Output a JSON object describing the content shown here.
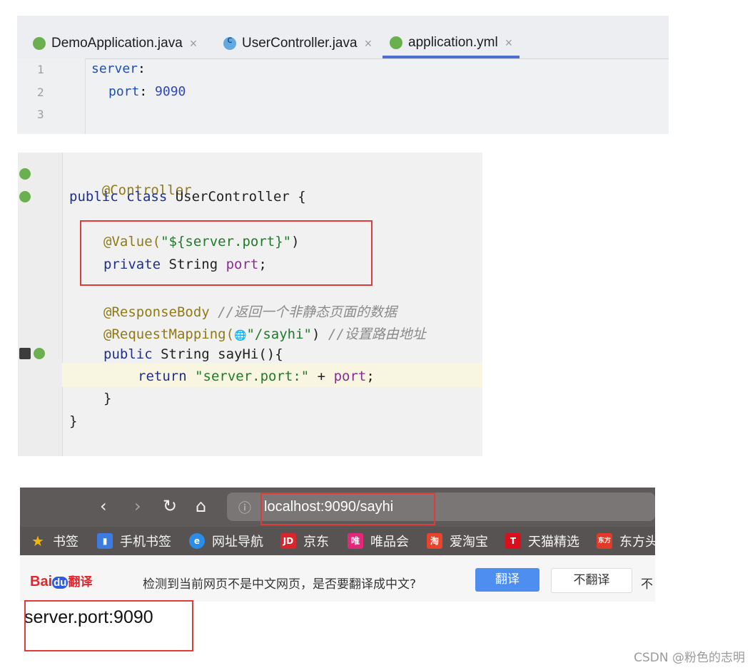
{
  "ide_tabs": {
    "tabs": [
      {
        "label": "DemoApplication.java",
        "icon": "spring-app-icon"
      },
      {
        "label": "UserController.java",
        "icon": "class-icon"
      },
      {
        "label": "application.yml",
        "icon": "spring-config-icon",
        "active": true
      }
    ],
    "close_glyph": "×"
  },
  "yaml_editor": {
    "line_numbers": [
      "1",
      "2",
      "3"
    ],
    "line1_key": "server",
    "line1_colon": ":",
    "line2_key": "port",
    "line2_colon": ":",
    "line2_value": "9090"
  },
  "java_editor": {
    "line_annotation": "@Controller",
    "line_class_kw": "public class",
    "line_class_name": " UserController {",
    "value_annot": "@Value(",
    "value_str": "\"${server.port}\"",
    "value_close": ")",
    "field_kw": "private",
    "field_type": " String ",
    "field_name": "port",
    "field_semi": ";",
    "respbody": "@ResponseBody",
    "respbody_comment": " //返回一个非静态页面的数据",
    "reqmap_annot": "@RequestMapping(",
    "reqmap_globe": "🌐",
    "reqmap_str": "\"/sayhi\"",
    "reqmap_close": ")",
    "reqmap_comment": " //设置路由地址",
    "method_kw": "public",
    "method_sig": " String sayHi(){",
    "return_kw": "return",
    "return_str": " \"server.port:\"",
    "return_plus": " + ",
    "return_field": "port",
    "return_semi": ";",
    "method_close": "}",
    "class_close": "}"
  },
  "browser": {
    "nav": {
      "back": "‹",
      "forward": "›",
      "reload": "↻",
      "home": "⌂"
    },
    "info_icon": "ⓘ",
    "url": "localhost:9090/sayhi",
    "bookmarks": [
      {
        "label": "书签",
        "icon": "star-icon",
        "color": "#f5b800",
        "glyph": "★"
      },
      {
        "label": "手机书签",
        "icon": "phone-bookmark-icon",
        "color": "#3d7be0",
        "glyph": "▮"
      },
      {
        "label": "网址导航",
        "icon": "ie-icon",
        "color": "#2b8de8",
        "glyph": "e"
      },
      {
        "label": "京东",
        "icon": "jd-icon",
        "color": "#d9262c",
        "glyph": "JD"
      },
      {
        "label": "唯品会",
        "icon": "vip-icon",
        "color": "#e1287a",
        "glyph": "唯"
      },
      {
        "label": "爱淘宝",
        "icon": "taobao-icon",
        "color": "#e8442c",
        "glyph": "淘"
      },
      {
        "label": "天猫精选",
        "icon": "tmall-icon",
        "color": "#d8101d",
        "glyph": "T"
      },
      {
        "label": "东方头",
        "icon": "dongfang-icon",
        "color": "#e03a2a",
        "glyph": "东方"
      }
    ],
    "translate_bar": {
      "brand": "Bai",
      "brand_du": "du",
      "brand_suffix": "翻译",
      "message": "检测到当前网页不是中文网页，是否要翻译成中文?",
      "translate_button": "翻译",
      "no_translate_button": "不翻译",
      "more": "不"
    }
  },
  "page_output": "server.port:9090",
  "watermark": "CSDN @粉色的志明"
}
